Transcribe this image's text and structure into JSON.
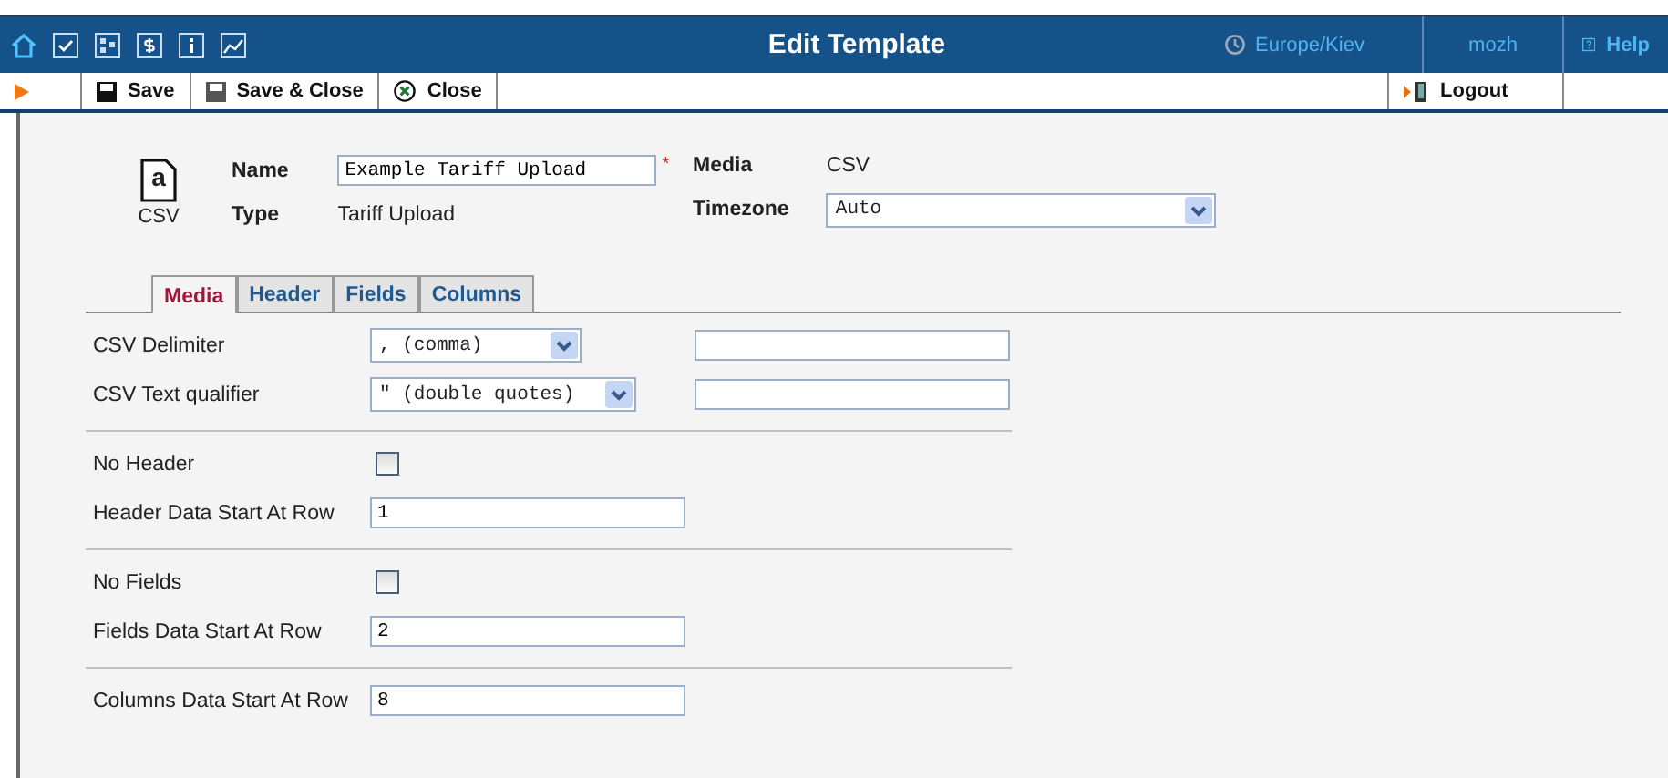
{
  "nav": {
    "title": "Edit Template",
    "timezone": "Europe/Kiev",
    "user": "mozh",
    "help": "Help"
  },
  "toolbar": {
    "buttons": [
      {
        "kind": "save",
        "label": "Save"
      },
      {
        "kind": "save_close",
        "label": "Save & Close"
      },
      {
        "kind": "close",
        "label": "Close"
      }
    ],
    "logout": "Logout"
  },
  "header": {
    "icon_glyph": "a",
    "icon_label": "CSV",
    "name": {
      "label": "Name",
      "value": "Example Tariff Upload",
      "required_mark": "*"
    },
    "type": {
      "label": "Type",
      "value": "Tariff Upload"
    },
    "media": {
      "label": "Media",
      "value": "CSV"
    },
    "timezone": {
      "label": "Timezone",
      "value": "Auto"
    }
  },
  "tabs": [
    {
      "label": "Media",
      "selected": true
    },
    {
      "label": "Header",
      "selected": false
    },
    {
      "label": "Fields",
      "selected": false
    },
    {
      "label": "Columns",
      "selected": false
    }
  ],
  "sections": [
    {
      "rows": [
        {
          "kind": "select",
          "label": "CSV Delimiter",
          "value": ", (comma)",
          "extra_field": true
        },
        {
          "kind": "select",
          "label": "CSV Text qualifier",
          "value": "\" (double quotes)",
          "extra_field": true
        }
      ]
    },
    {
      "rows": [
        {
          "kind": "checkbox",
          "label": "No Header",
          "checked": false
        },
        {
          "kind": "text",
          "label": "Header Data Start At Row",
          "value": "1"
        }
      ]
    },
    {
      "rows": [
        {
          "kind": "checkbox",
          "label": "No Fields",
          "checked": false
        },
        {
          "kind": "text",
          "label": "Fields Data Start At Row",
          "value": "2"
        }
      ]
    },
    {
      "rows": [
        {
          "kind": "text",
          "label": "Columns Data Start At Row",
          "value": "8"
        }
      ]
    }
  ]
}
